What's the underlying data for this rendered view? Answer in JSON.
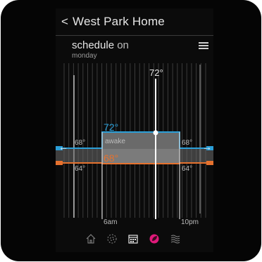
{
  "header": {
    "back_glyph": "<",
    "title": "West Park Home"
  },
  "schedule": {
    "label": "schedule",
    "state": "on",
    "day": "monday"
  },
  "current_temp": "72°",
  "block": {
    "name": "awake",
    "heat_to": "72°",
    "cool_to": "68°",
    "start_label": "6am",
    "end_label": "10pm"
  },
  "side_labels": {
    "left_high": "68°",
    "left_low": "64°",
    "right_high": "68°",
    "right_low": "64°"
  },
  "arrows": {
    "prev": "←",
    "next": "→"
  },
  "colors": {
    "heat": "#2b9fd8",
    "cool": "#e6722e",
    "accent_active": "#e0197a"
  },
  "nav": [
    {
      "icon": "home-icon",
      "active": false
    },
    {
      "icon": "fan-icon",
      "active": false
    },
    {
      "icon": "calendar-icon",
      "active": true
    },
    {
      "icon": "leaf-icon",
      "active": false
    },
    {
      "icon": "heat-waves-icon",
      "active": false
    }
  ]
}
